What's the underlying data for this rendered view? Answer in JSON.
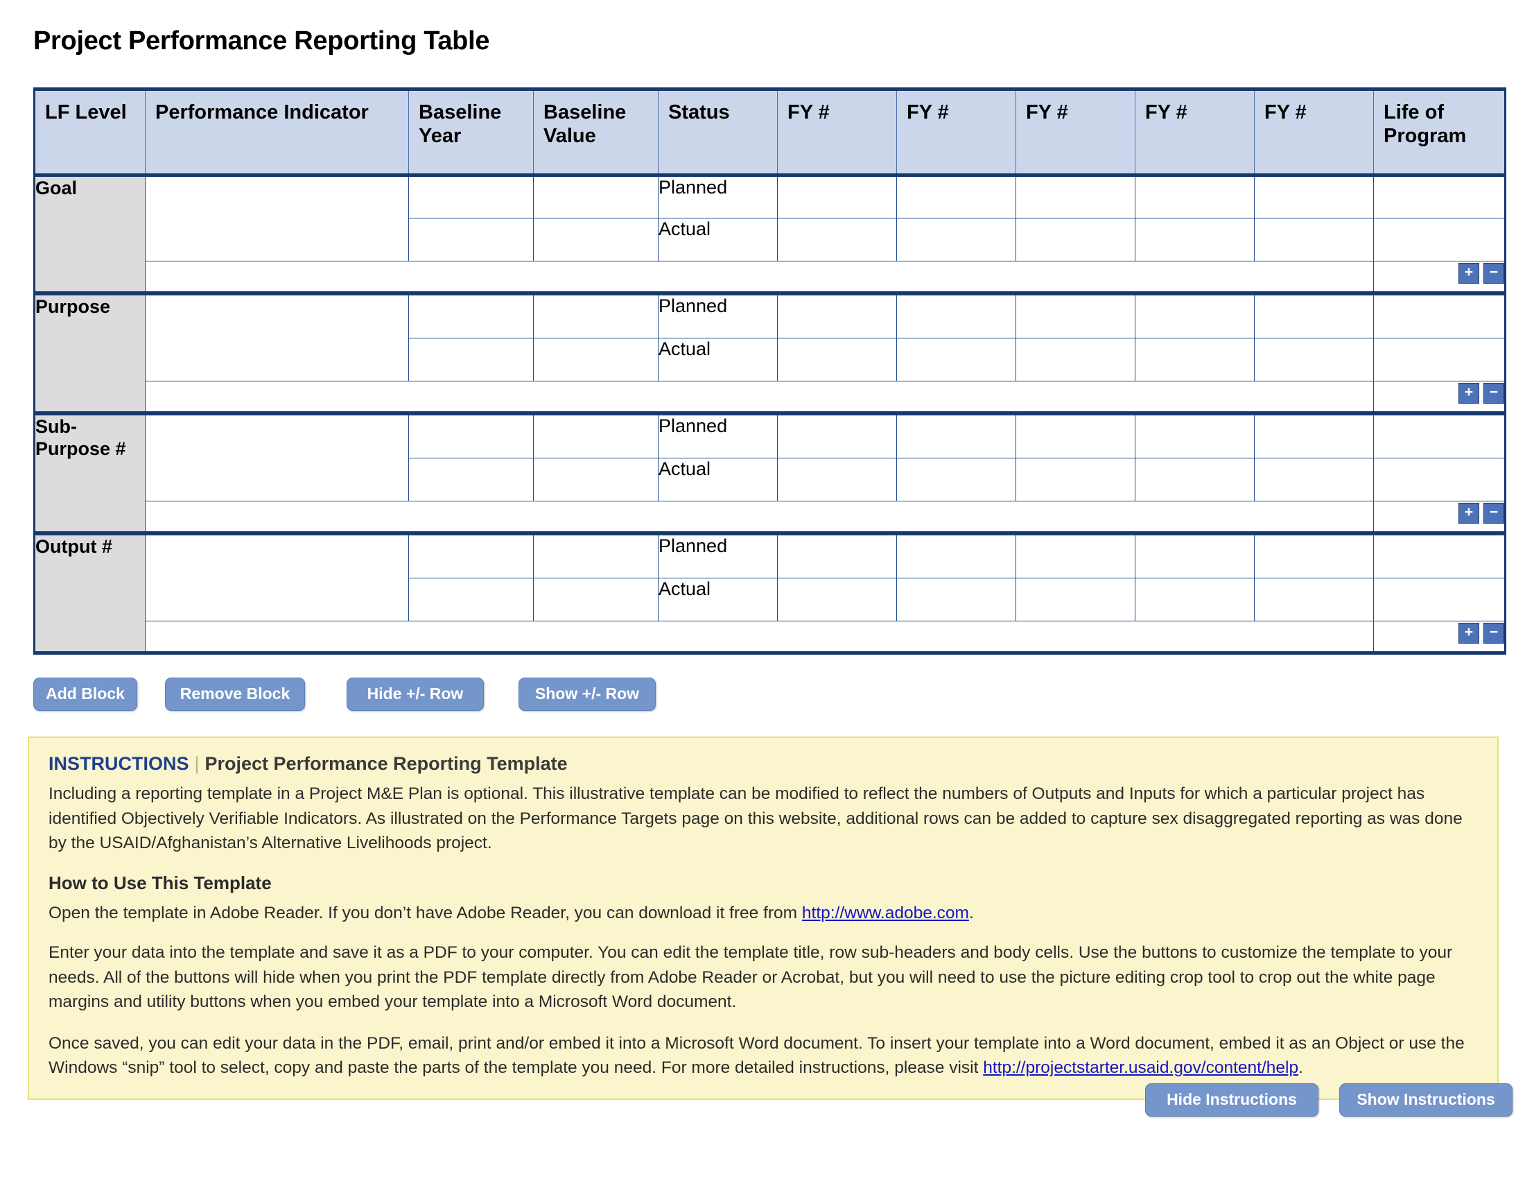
{
  "page": {
    "title": "Project Performance Reporting Table"
  },
  "table": {
    "columns": [
      "LF Level",
      "Performance Indicator",
      "Baseline Year",
      "Baseline Value",
      "Status",
      "FY #",
      "FY #",
      "FY #",
      "FY #",
      "FY #",
      "Life of Program"
    ],
    "status_labels": {
      "planned": "Planned",
      "actual": "Actual"
    },
    "plus_label": "+",
    "minus_label": "−",
    "blocks": [
      {
        "lf_level": "Goal"
      },
      {
        "lf_level": "Purpose"
      },
      {
        "lf_level": "Sub-Purpose #"
      },
      {
        "lf_level": "Output #"
      }
    ]
  },
  "toolbar": {
    "add_block": "Add Block",
    "remove_block": "Remove Block",
    "hide_pm_row": "Hide +/- Row",
    "show_pm_row": "Show +/- Row"
  },
  "instructions": {
    "lead": "INSTRUCTIONS",
    "separator": "|",
    "subtitle": "Project Performance Reporting Template",
    "intro": "Including a reporting template in a Project M&E Plan is optional. This illustrative template can be modified to reflect the numbers of Outputs and Inputs for which a particular project has identified Objectively Verifiable Indicators. As illustrated on the Performance Targets page on this website, additional rows can be added to capture sex disaggregated reporting as was done by the USAID/Afghanistan’s Alternative Livelihoods project.",
    "how_to_heading": "How to Use This Template",
    "para1_before": "Open the template in Adobe Reader. If you don’t have Adobe Reader, you can download it free from ",
    "para1_link": "http://www.adobe.com",
    "para1_after": ".",
    "para2": "Enter your data into the template and save it as a PDF to your computer. You can edit the template title, row sub-headers and body cells. Use the buttons to customize the template to your needs. All of the buttons will hide when you print the PDF template directly from Adobe Reader or Acrobat, but you will need to use the picture editing crop tool to crop out the white page margins and utility buttons when you embed your template into a Microsoft Word document.",
    "para3_before": "Once saved, you can edit your data in the PDF, email, print and/or embed it into a Microsoft Word document. To insert your template into a Word document, embed it as an Object or use the Windows “snip” tool to select, copy and paste the parts of the template you need. For more detailed instructions, please visit ",
    "para3_link": "http://projectstarter.usaid.gov/content/help",
    "para3_after": ".",
    "hide_button": "Hide Instructions",
    "show_button": "Show Instructions"
  },
  "colors": {
    "header_bg": "#ccd6ea",
    "rule": "#16386e",
    "lf_bg": "#dcdcdc",
    "button_bg": "#7596cb",
    "panel_bg": "#fbf5cd",
    "panel_border": "#e8e07a",
    "link": "#1414c8"
  }
}
